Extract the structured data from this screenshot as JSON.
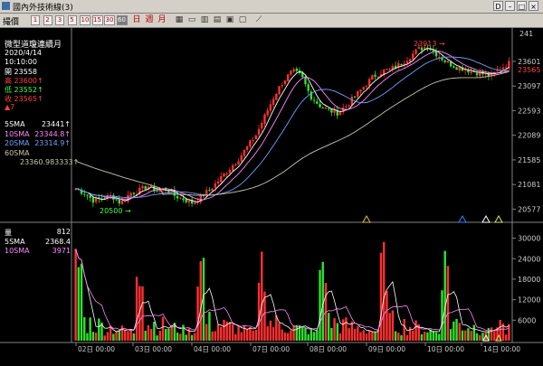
{
  "window": {
    "title": "國內外技術線(3)"
  },
  "toolbar": {
    "label": "撮價",
    "periods": [
      "1",
      "2",
      "3",
      "5",
      "10",
      "15",
      "30",
      "60"
    ],
    "selected_period": "60",
    "extra": [
      "日",
      "週",
      "月"
    ]
  },
  "info": {
    "name": "微型道瓊連續月",
    "date": "2020/4/14",
    "time": "10:10:00",
    "open_label": "開",
    "open": "23558",
    "high_label": "高",
    "high": "23600",
    "low_label": "低",
    "low": "23552",
    "close_label": "收",
    "close": "23565",
    "change": "▲7"
  },
  "ma": [
    {
      "label": "5SMA",
      "value": "23441",
      "color": "#ffffff"
    },
    {
      "label": "10SMA",
      "value": "23344.8",
      "color": "#ff88ff"
    },
    {
      "label": "20SMA",
      "value": "23314.9",
      "color": "#6fa0ff"
    },
    {
      "label": "60SMA",
      "value": "23360.983333",
      "color": "#c8c8a0"
    }
  ],
  "volume_info": {
    "label": "量",
    "value": "812",
    "ma": [
      {
        "label": "5SMA",
        "value": "2368.4"
      },
      {
        "label": "10SMA",
        "value": "3971"
      }
    ]
  },
  "annotations": {
    "high_mark": "23913",
    "low_mark": "20500"
  },
  "colors": {
    "up": "#ff3030",
    "down": "#30e030",
    "axis": "#808080"
  },
  "chart_data": {
    "type": "candlestick",
    "price_axis": [
      "23601",
      "23097",
      "22593",
      "22089",
      "21585",
      "21081",
      "20577"
    ],
    "price_top": "241",
    "last_price_tag": "23565",
    "volume_axis": [
      "30000",
      "24000",
      "18000",
      "12000",
      "6000"
    ],
    "time_labels": [
      "02日 00:00",
      "03日 00:00",
      "04日 00:00",
      "07日 00:00",
      "08日 00:00",
      "09日 00:00",
      "10日 00:00",
      "14日 00:00"
    ],
    "close_path": [
      21000,
      20900,
      20750,
      20800,
      20850,
      20700,
      20900,
      20950,
      21050,
      20950,
      21000,
      20850,
      20780,
      20700,
      20850,
      21000,
      21200,
      21400,
      21600,
      21850,
      22100,
      22500,
      22900,
      23200,
      23400,
      23300,
      22900,
      22700,
      22600,
      22550,
      22700,
      22900,
      23100,
      23300,
      23400,
      23450,
      23550,
      23700,
      23850,
      23913,
      23750,
      23600,
      23500,
      23450,
      23400,
      23350,
      23300,
      23450,
      23565
    ],
    "ylim": [
      20400,
      24100
    ],
    "volume_ylim": [
      0,
      32000
    ]
  }
}
